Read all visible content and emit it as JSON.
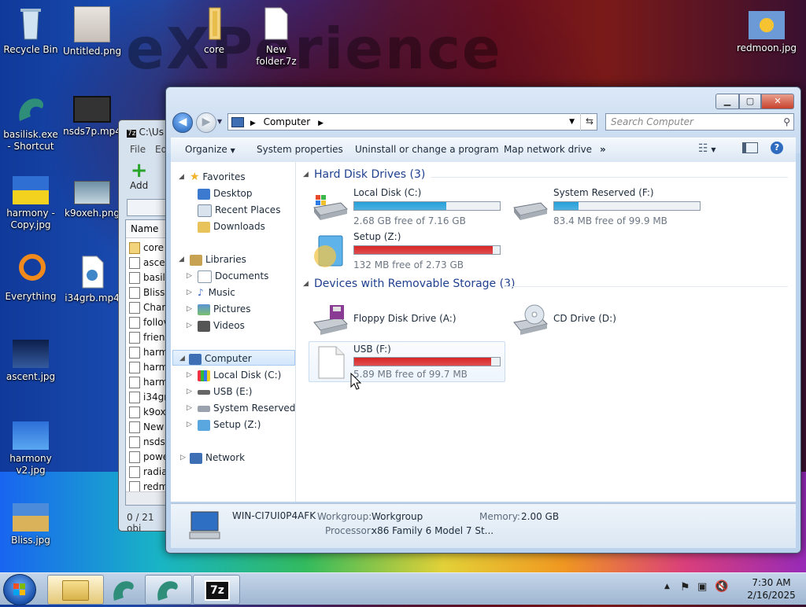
{
  "desktop": {
    "watermark": "eXPerience",
    "icons": [
      {
        "label": "Recycle Bin",
        "icon": "recycle-bin-icon"
      },
      {
        "label": "Untitled.png",
        "icon": "image-icon"
      },
      {
        "label": "core",
        "icon": "folder-icon"
      },
      {
        "label": "New folder.7z",
        "icon": "file-icon"
      },
      {
        "label": "redmoon.jpg",
        "icon": "image-icon"
      },
      {
        "label": "basilisk.exe - Shortcut",
        "icon": "basilisk-icon"
      },
      {
        "label": "nsds7p.mp4",
        "icon": "video-icon"
      },
      {
        "label": "harmony - Copy.jpg",
        "icon": "image-icon"
      },
      {
        "label": "k9oxeh.png",
        "icon": "image-icon"
      },
      {
        "label": "Everything",
        "icon": "everything-icon"
      },
      {
        "label": "i34grb.mp4",
        "icon": "media-file-icon"
      },
      {
        "label": "ascent.jpg",
        "icon": "image-icon"
      },
      {
        "label": "harmony v2.jpg",
        "icon": "image-icon"
      },
      {
        "label": "Bliss.jpg",
        "icon": "image-icon"
      }
    ]
  },
  "zip_window": {
    "title": "C:\\Us",
    "menu_file": "File",
    "menu_edit": "Ed",
    "add_label": "Add",
    "col_name": "Name",
    "rows": [
      "core",
      "ascen",
      "basili",
      "Bliss.",
      "Chara",
      "follov",
      "friend",
      "harm",
      "harm",
      "harm",
      "i34gr",
      "k9oxe",
      "New",
      "nsds7",
      "powe",
      "radia",
      "redm"
    ],
    "status": "0 / 21 obj"
  },
  "explorer": {
    "address": "Computer",
    "search_placeholder": "Search Computer",
    "toolbar": {
      "organize": "Organize",
      "system_properties": "System properties",
      "uninstall": "Uninstall or change a program",
      "map_drive": "Map network drive",
      "more": "»"
    },
    "nav": {
      "favorites": "Favorites",
      "desktop": "Desktop",
      "recent_places": "Recent Places",
      "downloads": "Downloads",
      "libraries": "Libraries",
      "documents": "Documents",
      "music": "Music",
      "pictures": "Pictures",
      "videos": "Videos",
      "computer": "Computer",
      "local_disk": "Local Disk (C:)",
      "usb": "USB (E:)",
      "system_reserved": "System Reserved (F:)",
      "setup": "Setup (Z:)",
      "network": "Network"
    },
    "groups": {
      "hard_disks": "Hard Disk Drives (3)",
      "removable": "Devices with Removable Storage (3)"
    },
    "drives": {
      "c": {
        "name": "Local Disk (C:)",
        "free": "2.68 GB free of 7.16 GB",
        "used_fraction": 0.63,
        "bar_color": "#26a0da"
      },
      "f": {
        "name": "System Reserved (F:)",
        "free": "83.4 MB free of 99.9 MB",
        "used_fraction": 0.17,
        "bar_color": "#26a0da"
      },
      "z": {
        "name": "Setup (Z:)",
        "free": "132 MB free of 2.73 GB",
        "used_fraction": 0.95,
        "bar_color": "#da2626"
      },
      "a": {
        "name": "Floppy Disk Drive (A:)"
      },
      "d": {
        "name": "CD Drive (D:)"
      },
      "usb": {
        "name": "USB (F:)",
        "free": "5.89 MB free of 99.7 MB",
        "used_fraction": 0.94,
        "bar_color": "#da2626"
      }
    },
    "status": {
      "computer_name": "WIN-CI7UI0P4AFK",
      "workgroup_label": "Workgroup:",
      "workgroup_value": "Workgroup",
      "memory_label": "Memory:",
      "memory_value": "2.00 GB",
      "processor_label": "Processor:",
      "processor_value": "x86 Family 6 Model 7 St..."
    }
  },
  "taskbar": {
    "time": "7:30 AM",
    "date": "2/16/2025",
    "zip_label": "7z"
  }
}
